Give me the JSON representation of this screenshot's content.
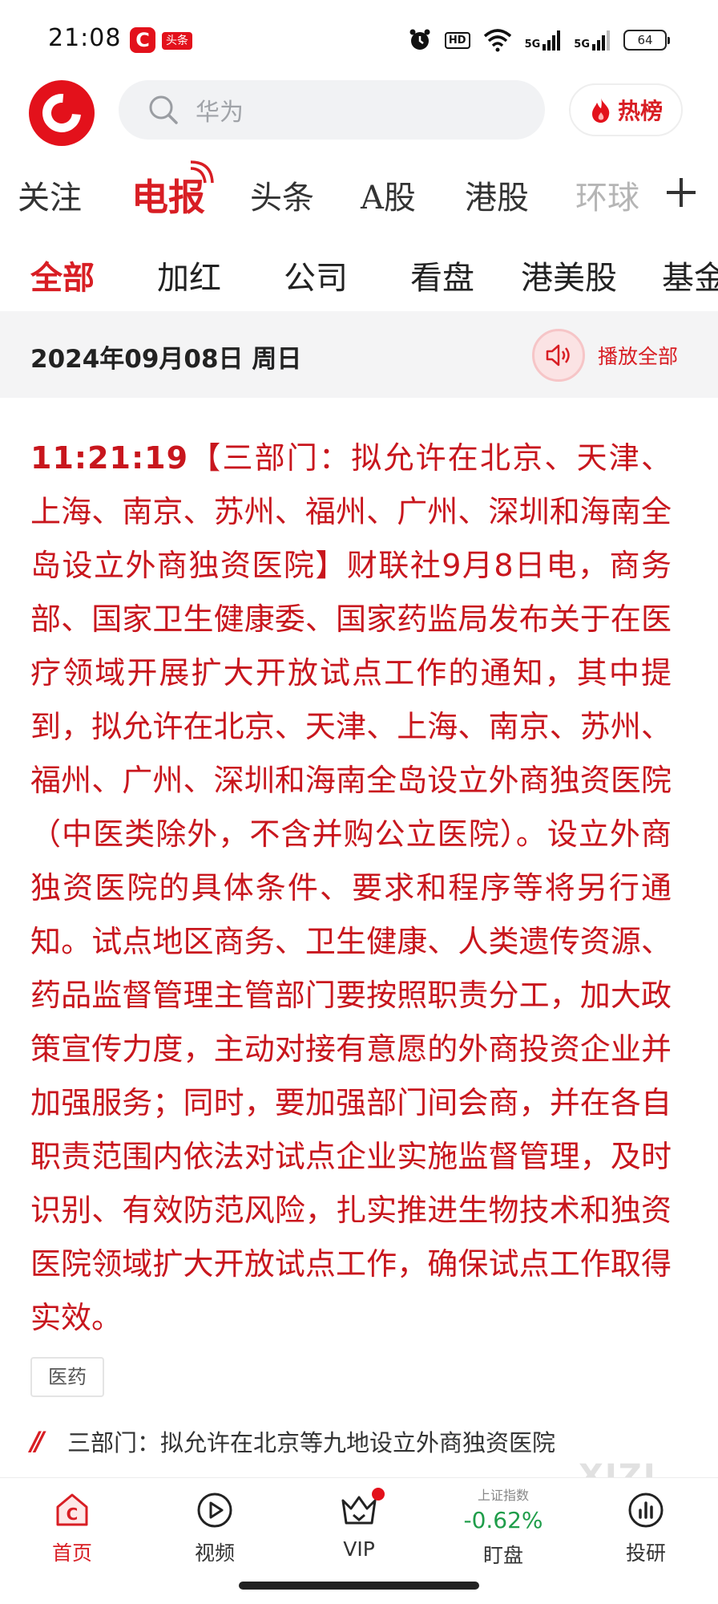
{
  "status_bar": {
    "time": "21:08",
    "app_badge": "头条",
    "hd_label": "HD",
    "net1_label": "5G",
    "net2_label": "5G",
    "battery": "64"
  },
  "header": {
    "search_placeholder": "华为",
    "hot_label": "热榜"
  },
  "tabs": [
    "关注",
    "电报",
    "头条",
    "A股",
    "港股",
    "环球"
  ],
  "subtabs": [
    "全部",
    "加红",
    "公司",
    "看盘",
    "港美股",
    "基金"
  ],
  "date_bar": {
    "date": "2024年09月08日 周日",
    "play_all": "播放全部"
  },
  "article": {
    "time": "11:21:19",
    "title": "【三部门：拟允许在北京、天津、上海、南京、苏州、福州、广州、深圳和海南全岛设立外商独资医院】",
    "body": "财联社9月8日电，商务部、国家卫生健康委、国家药监局发布关于在医疗领域开展扩大开放试点工作的通知，其中提到，拟允许在北京、天津、上海、南京、苏州、福州、广州、深圳和海南全岛设立外商独资医院（中医类除外，不含并购公立医院）。设立外商独资医院的具体条件、要求和程序等将另行通知。试点地区商务、卫生健康、人类遗传资源、药品监督管理主管部门要按照职责分工，加大政策宣传力度，主动对接有意愿的外商投资企业并加强服务；同时，要加强部门间会商，并在各自职责范围内依法对试点企业实施监督管理，及时识别、有效防范风险，扎实推进生物技术和独资医院领域扩大开放试点工作，确保试点工作取得实效。",
    "tag": "医药",
    "related_mark": "//",
    "related": "三部门：拟允许在北京等九地设立外商独资医院"
  },
  "bottom_nav": {
    "home": "首页",
    "video": "视频",
    "vip": "VIP",
    "index_name": "上证指数",
    "index_value": "-0.62%",
    "market": "盯盘",
    "research": "投研"
  },
  "watermark": "XIZI",
  "colors": {
    "accent": "#d81e24",
    "brand": "#e3111b",
    "down": "#1f9d4a"
  }
}
